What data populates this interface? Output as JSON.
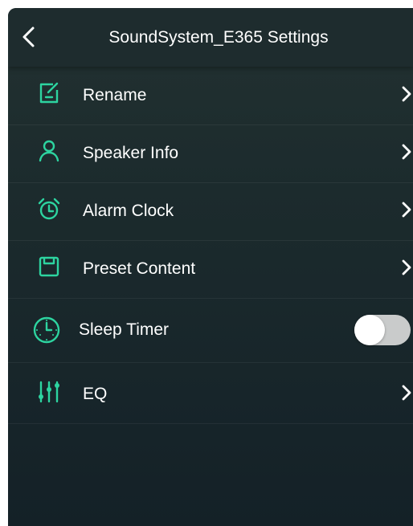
{
  "header": {
    "title": "SoundSystem_E365 Settings"
  },
  "colors": {
    "accent": "#2dd4a0",
    "background": "#1c2b2d",
    "text": "#ffffff"
  },
  "settings": [
    {
      "label": "Rename",
      "icon": "edit-icon",
      "control": "chevron"
    },
    {
      "label": "Speaker Info",
      "icon": "user-icon",
      "control": "chevron"
    },
    {
      "label": "Alarm Clock",
      "icon": "alarm-clock-icon",
      "control": "chevron"
    },
    {
      "label": "Preset Content",
      "icon": "preset-icon",
      "control": "chevron"
    },
    {
      "label": "Sleep Timer",
      "icon": "clock-icon",
      "control": "toggle",
      "enabled": false
    },
    {
      "label": "EQ",
      "icon": "equalizer-icon",
      "control": "chevron"
    }
  ]
}
